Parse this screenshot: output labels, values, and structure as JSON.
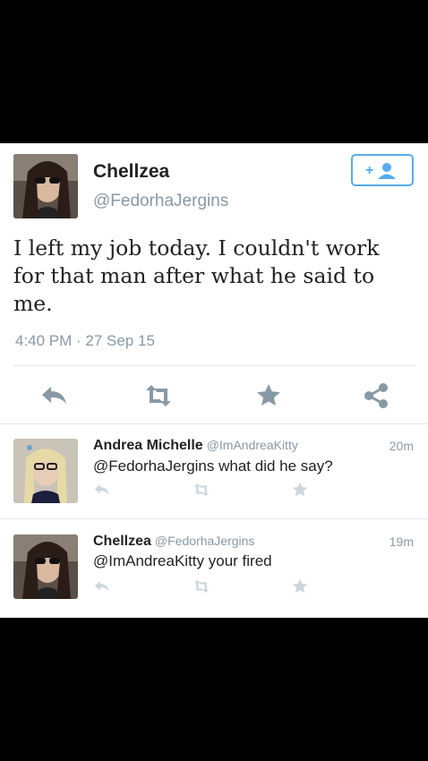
{
  "tweet": {
    "name": "Chellzea",
    "handle": "@FedorhaJergins",
    "text": "I left my job today. I couldn't work for that man after what he said to me.",
    "timestamp": "4:40 PM · 27 Sep 15",
    "actions": [
      "reply-icon",
      "retweet-icon",
      "favorite-icon",
      "share-icon"
    ]
  },
  "replies": [
    {
      "name": "Andrea Michelle",
      "handle": "@ImAndreaKitty",
      "time": "20m",
      "text": "@FedorhaJergins what did he say?"
    },
    {
      "name": "Chellzea",
      "handle": "@FedorhaJergins",
      "time": "19m",
      "text": "@ImAndreaKitty your fired"
    }
  ],
  "colors": {
    "accent": "#55acee",
    "icon_gray": "#8899a6",
    "light_icon": "#ccd6dd",
    "text": "#222222",
    "background": "#000000"
  }
}
